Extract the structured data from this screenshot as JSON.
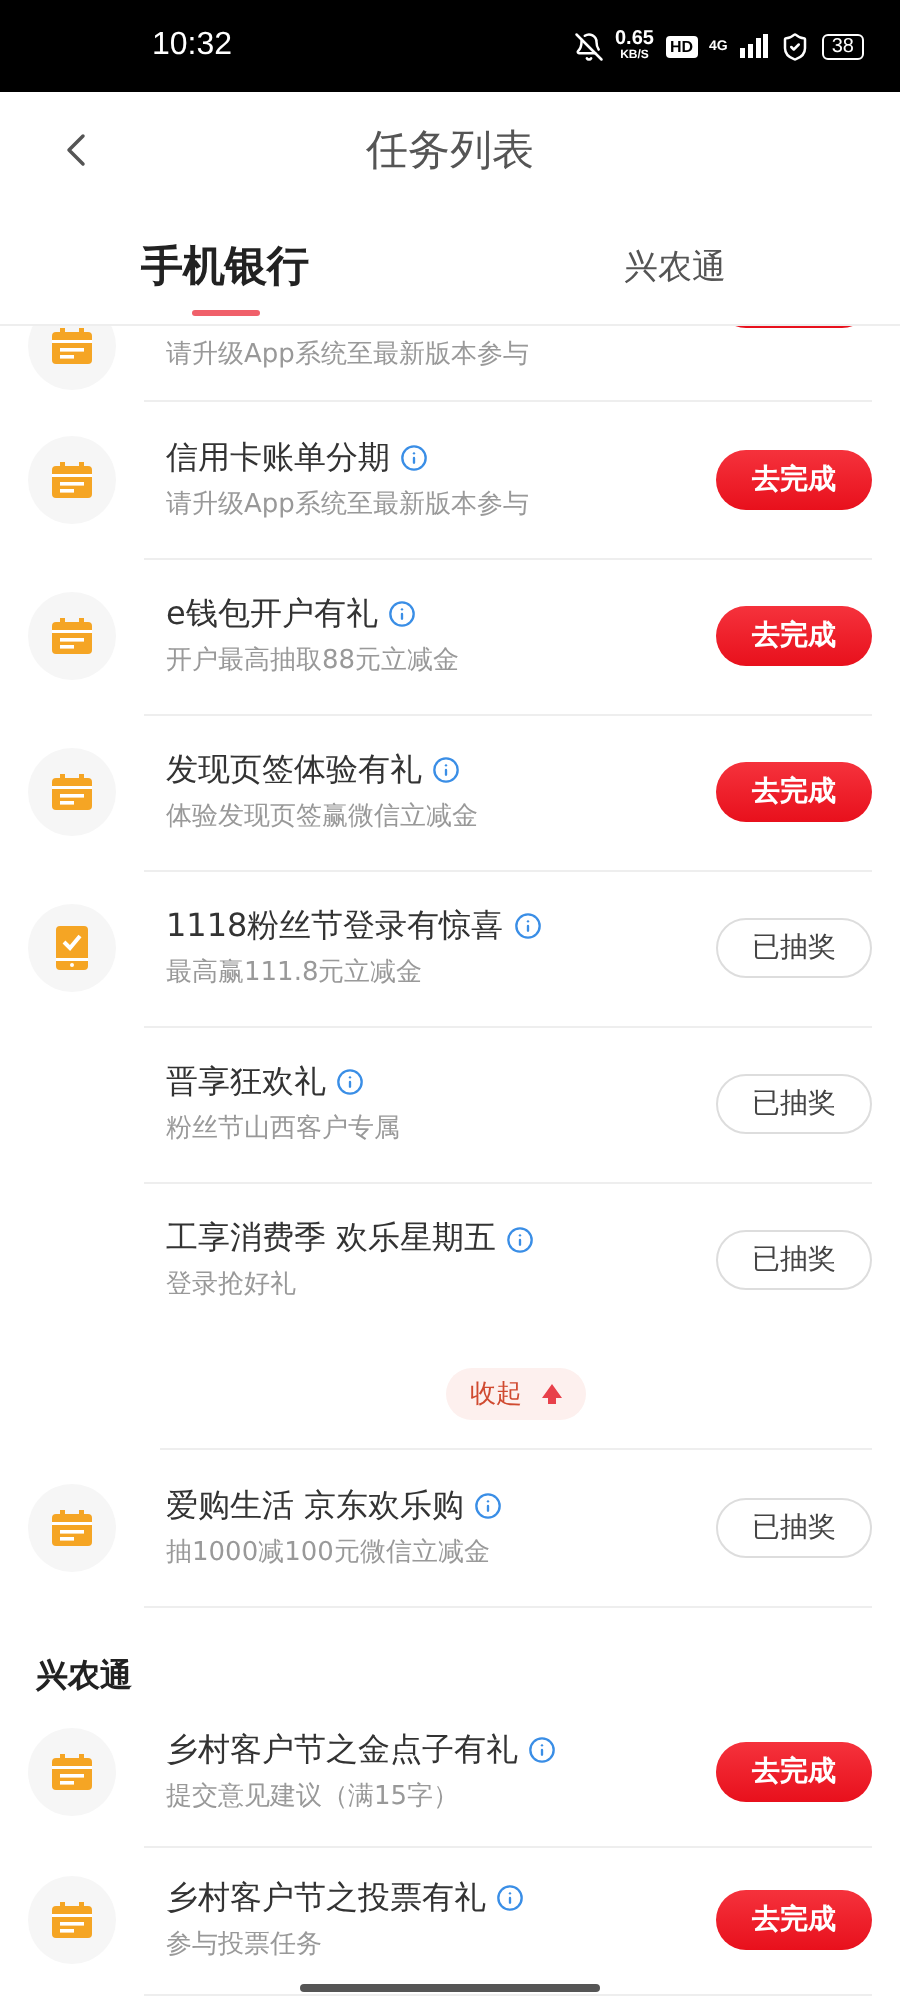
{
  "status_bar": {
    "time": "10:32",
    "speed": "0.65",
    "speed_unit": "KB/S",
    "hd": "HD",
    "network": "4G",
    "battery": "38"
  },
  "header": {
    "title": "任务列表"
  },
  "tabs": [
    {
      "label": "手机银行",
      "selected": true
    },
    {
      "label": "兴农通",
      "selected": false
    }
  ],
  "sections": [
    {
      "rows": [
        {
          "kind": "calendar",
          "subtitle": "请升级App系统至最新版本参与",
          "action": {
            "done": false
          },
          "partial": true
        },
        {
          "kind": "calendar",
          "title": "信用卡账单分期",
          "subtitle": "请升级App系统至最新版本参与",
          "action": {
            "label": "去完成",
            "done": false
          }
        },
        {
          "kind": "calendar",
          "title": "e钱包开户有礼",
          "subtitle": "开户最高抽取88元立减金",
          "action": {
            "label": "去完成",
            "done": false
          }
        },
        {
          "kind": "calendar",
          "title": "发现页签体验有礼",
          "subtitle": "体验发现页签赢微信立减金",
          "action": {
            "label": "去完成",
            "done": false
          }
        },
        {
          "kind": "phone",
          "title": "1118粉丝节登录有惊喜",
          "subtitle": "最高赢111.8元立减金",
          "action": {
            "label": "已抽奖",
            "done": true
          }
        },
        {
          "kind": "plain",
          "title": "晋享狂欢礼",
          "subtitle": "粉丝节山西客户专属",
          "action": {
            "label": "已抽奖",
            "done": true
          }
        },
        {
          "kind": "plain",
          "title": "工享消费季 欢乐星期五",
          "subtitle": "登录抢好礼",
          "action": {
            "label": "已抽奖",
            "done": true
          },
          "last_in_group": true
        },
        {
          "kind": "collapse",
          "label": "收起",
          "expanded": true
        },
        {
          "kind": "calendar",
          "title": "爱购生活 京东欢乐购",
          "subtitle": "抽1000减100元微信立减金",
          "action": {
            "label": "已抽奖",
            "done": true
          }
        }
      ]
    },
    {
      "heading": "兴农通",
      "rows": [
        {
          "kind": "calendar",
          "title": "乡村客户节之金点子有礼",
          "subtitle": "提交意见建议（满15字）",
          "action": {
            "label": "去完成",
            "done": false
          }
        },
        {
          "kind": "calendar",
          "title": "乡村客户节之投票有礼",
          "subtitle": "参与投票任务",
          "action": {
            "label": "去完成",
            "done": false
          }
        }
      ]
    }
  ]
}
